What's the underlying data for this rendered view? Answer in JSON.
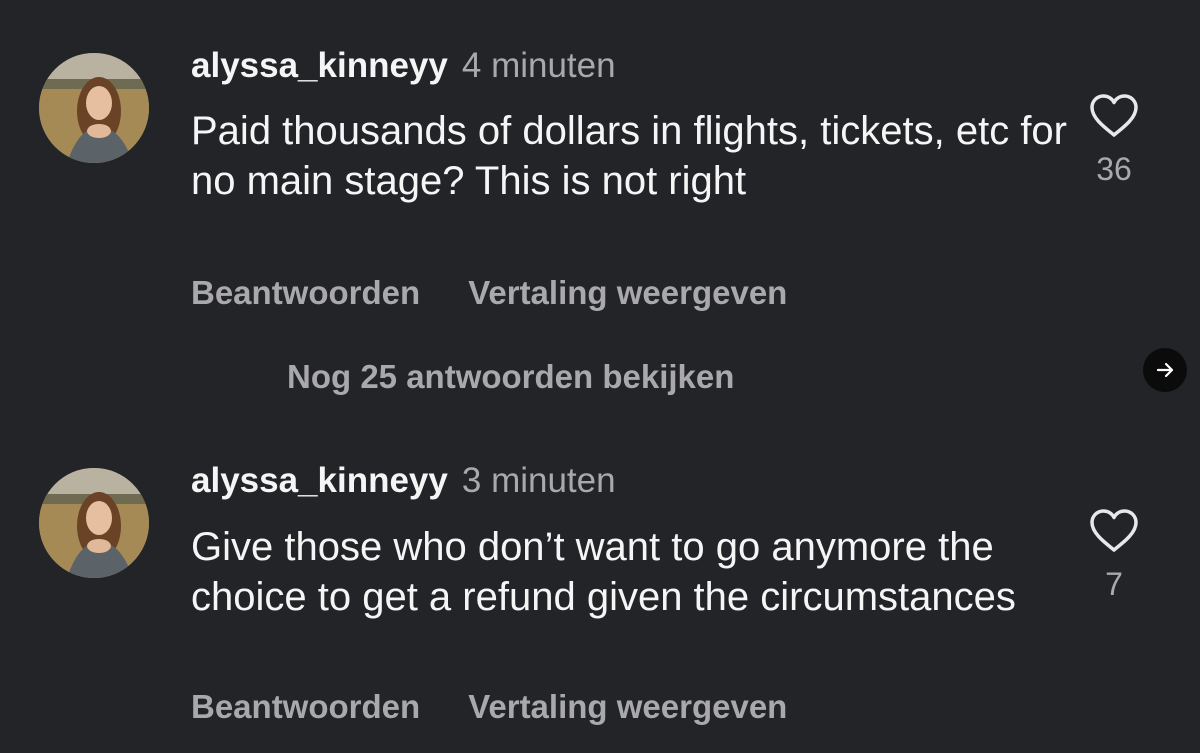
{
  "comments": [
    {
      "username": "alyssa_kinneyy",
      "time": "4 minuten",
      "text": "Paid thousands of dollars in flights, tickets, etc for no main stage? This is not right",
      "likes": "36",
      "reply_label": "Beantwoorden",
      "translate_label": "Vertaling weergeven"
    },
    {
      "username": "alyssa_kinneyy",
      "time": "3 minuten",
      "text": "Give those who don’t want to go anymore the choice to get a refund given the circumstances",
      "likes": "7",
      "reply_label": "Beantwoorden",
      "translate_label": "Vertaling weergeven"
    }
  ],
  "replies": {
    "view_more_label": "Nog 25 antwoorden bekijken"
  },
  "icons": {
    "like": "heart-outline-icon",
    "next": "arrow-right-icon"
  },
  "colors": {
    "background": "#232428",
    "primary_text": "#f5f5f5",
    "secondary_text": "#a8a8ad"
  }
}
